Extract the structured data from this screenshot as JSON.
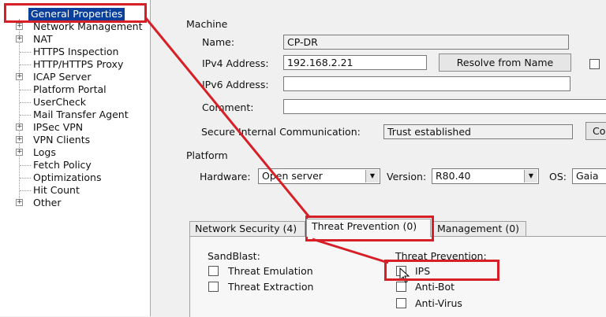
{
  "tree": {
    "items": [
      {
        "label": "General Properties",
        "expandable": false,
        "selected": true
      },
      {
        "label": "Network Management",
        "expandable": true
      },
      {
        "label": "NAT",
        "expandable": true
      },
      {
        "label": "HTTPS Inspection",
        "expandable": false
      },
      {
        "label": "HTTP/HTTPS Proxy",
        "expandable": false
      },
      {
        "label": "ICAP Server",
        "expandable": true
      },
      {
        "label": "Platform Portal",
        "expandable": false
      },
      {
        "label": "UserCheck",
        "expandable": false
      },
      {
        "label": "Mail Transfer Agent",
        "expandable": false
      },
      {
        "label": "IPSec VPN",
        "expandable": true
      },
      {
        "label": "VPN Clients",
        "expandable": true
      },
      {
        "label": "Logs",
        "expandable": true
      },
      {
        "label": "Fetch Policy",
        "expandable": false
      },
      {
        "label": "Optimizations",
        "expandable": false
      },
      {
        "label": "Hit Count",
        "expandable": false
      },
      {
        "label": "Other",
        "expandable": true
      }
    ]
  },
  "machine": {
    "group_label": "Machine",
    "name_label": "Name:",
    "name_value": "CP-DR",
    "ipv4_label": "IPv4 Address:",
    "ipv4_value": "192.168.2.21",
    "resolve_button": "Resolve from Name",
    "ipv6_label": "IPv6 Address:",
    "ipv6_value": "",
    "comment_label": "Comment:",
    "comment_value": "",
    "sic_label": "Secure Internal Communication:",
    "sic_value": "Trust established",
    "sic_button_partial": "Co"
  },
  "platform": {
    "group_label": "Platform",
    "hardware_label": "Hardware:",
    "hardware_value": "Open server",
    "version_label": "Version:",
    "version_value": "R80.40",
    "os_label": "OS:",
    "os_value": "Gaia"
  },
  "tabs": [
    {
      "label": "Network Security (4)",
      "active": false
    },
    {
      "label": "Threat Prevention (0)",
      "active": true
    },
    {
      "label": "Management (0)",
      "active": false
    }
  ],
  "threat_tab": {
    "sandblast_heading": "SandBlast:",
    "sandblast_items": [
      {
        "label": "Threat Emulation",
        "checked": false
      },
      {
        "label": "Threat Extraction",
        "checked": false
      }
    ],
    "tp_heading": "Threat Prevention:",
    "tp_items": [
      {
        "label": "IPS",
        "checked": false
      },
      {
        "label": "Anti-Bot",
        "checked": false
      },
      {
        "label": "Anti-Virus",
        "checked": false
      }
    ]
  },
  "annotation": {
    "color": "#d61f26"
  },
  "colors": {
    "selection": "#0a3f9c",
    "panel_bg": "#f0f0f0"
  }
}
